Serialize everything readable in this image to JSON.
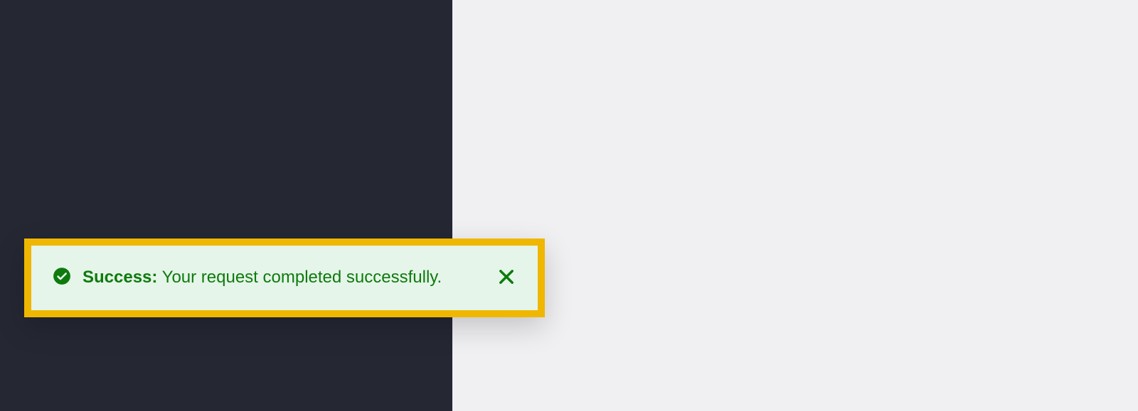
{
  "alert": {
    "type": "success",
    "title": "Success:",
    "message": "Your request completed successfully.",
    "colors": {
      "background": "#e5f5e9",
      "border": "#efb700",
      "text": "#0e7a0d",
      "icon": "#0e7a0d"
    }
  },
  "panels": {
    "left_bg": "#252733",
    "right_bg": "#f0f0f2"
  }
}
